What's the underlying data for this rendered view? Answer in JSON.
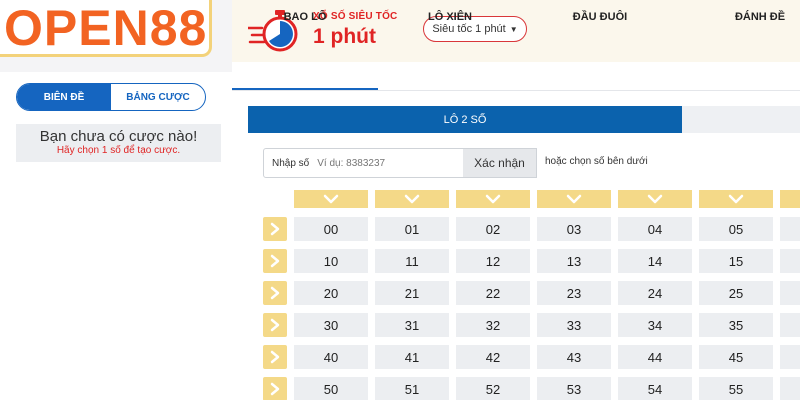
{
  "logo": {
    "text": "OPEN88"
  },
  "header": {
    "title_small": "XỔ SỐ SIÊU TỐC",
    "title_big": "1 phút",
    "dropdown_value": "Siêu tốc 1 phút",
    "colors": {
      "accent_red": "#e02424",
      "header_bg": "#fbf7ec"
    }
  },
  "left": {
    "tabs": [
      {
        "label": "BIÊN ĐỀ"
      },
      {
        "label": "BẢNG CƯỢC"
      }
    ],
    "empty_title": "Bạn chưa có cược nào!",
    "empty_sub": "Hãy chọn 1 số để tạo cược."
  },
  "main_tabs": [
    {
      "label": "BAO LÔ"
    },
    {
      "label": "LÔ XIÊN"
    },
    {
      "label": "ĐẦU ĐUÔI"
    },
    {
      "label": "ĐÁNH ĐỀ"
    }
  ],
  "subtab": {
    "label": "LÔ 2 SỐ"
  },
  "input": {
    "label": "Nhập số",
    "placeholder": "Ví dụ: 8383237",
    "confirm": "Xác nhận",
    "hint_prefix": "hoặc ",
    "hint_link": "chọn số bên dưới"
  },
  "grid": {
    "rows": [
      [
        "00",
        "01",
        "02",
        "03",
        "04",
        "05"
      ],
      [
        "10",
        "11",
        "12",
        "13",
        "14",
        "15"
      ],
      [
        "20",
        "21",
        "22",
        "23",
        "24",
        "25"
      ],
      [
        "30",
        "31",
        "32",
        "33",
        "34",
        "35"
      ],
      [
        "40",
        "41",
        "42",
        "43",
        "44",
        "45"
      ],
      [
        "50",
        "51",
        "52",
        "53",
        "54",
        "55"
      ]
    ]
  },
  "colors": {
    "primary_blue": "#1565c0",
    "arrow_yellow": "#f4d988",
    "logo_orange": "#f26322"
  }
}
